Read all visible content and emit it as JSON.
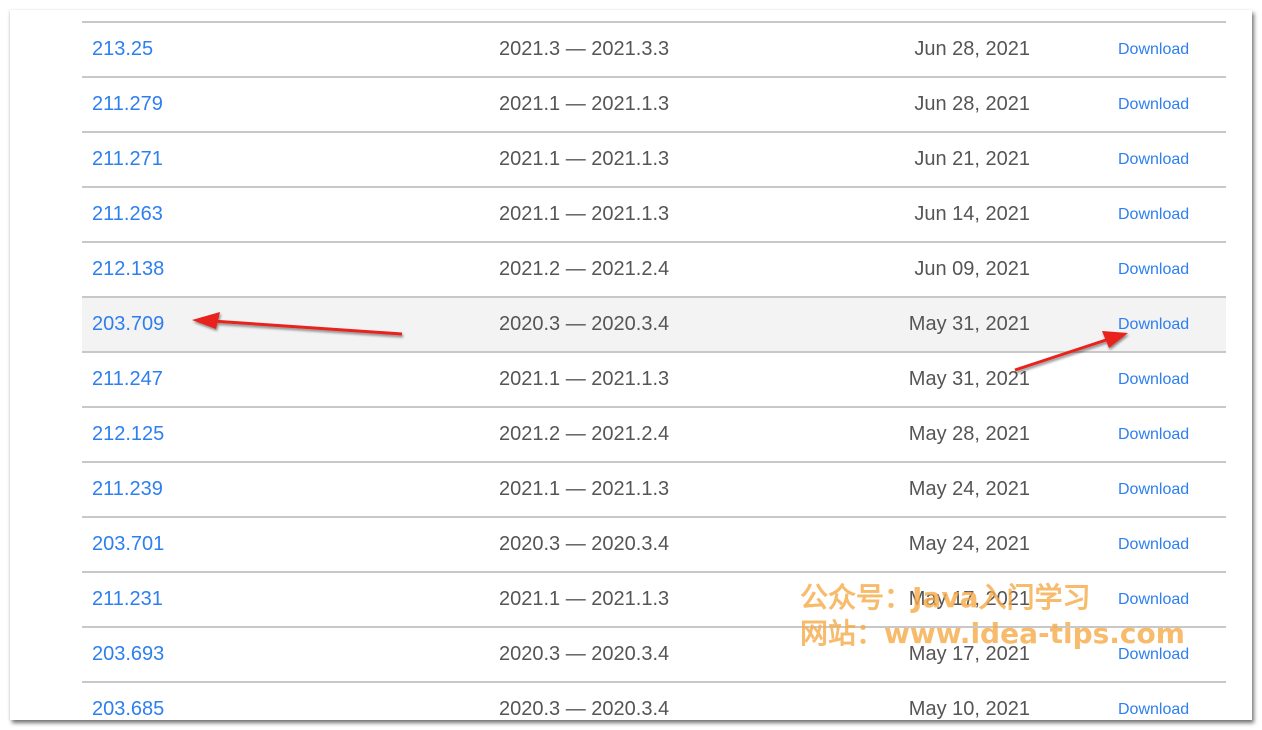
{
  "releases": {
    "download_label": "Download",
    "rows": [
      {
        "build": "213.25",
        "versions": "2021.3 — 2021.3.3",
        "date": "Jun 28, 2021",
        "highlighted": false
      },
      {
        "build": "211.279",
        "versions": "2021.1 — 2021.1.3",
        "date": "Jun 28, 2021",
        "highlighted": false
      },
      {
        "build": "211.271",
        "versions": "2021.1 — 2021.1.3",
        "date": "Jun 21, 2021",
        "highlighted": false
      },
      {
        "build": "211.263",
        "versions": "2021.1 — 2021.1.3",
        "date": "Jun 14, 2021",
        "highlighted": false
      },
      {
        "build": "212.138",
        "versions": "2021.2 — 2021.2.4",
        "date": "Jun 09, 2021",
        "highlighted": false
      },
      {
        "build": "203.709",
        "versions": "2020.3 — 2020.3.4",
        "date": "May 31, 2021",
        "highlighted": true
      },
      {
        "build": "211.247",
        "versions": "2021.1 — 2021.1.3",
        "date": "May 31, 2021",
        "highlighted": false
      },
      {
        "build": "212.125",
        "versions": "2021.2 — 2021.2.4",
        "date": "May 28, 2021",
        "highlighted": false
      },
      {
        "build": "211.239",
        "versions": "2021.1 — 2021.1.3",
        "date": "May 24, 2021",
        "highlighted": false
      },
      {
        "build": "203.701",
        "versions": "2020.3 — 2020.3.4",
        "date": "May 24, 2021",
        "highlighted": false
      },
      {
        "build": "211.231",
        "versions": "2021.1 — 2021.1.3",
        "date": "May 17, 2021",
        "highlighted": false
      },
      {
        "build": "203.693",
        "versions": "2020.3 — 2020.3.4",
        "date": "May 17, 2021",
        "highlighted": false
      },
      {
        "build": "203.685",
        "versions": "2020.3 — 2020.3.4",
        "date": "May 10, 2021",
        "highlighted": false
      }
    ]
  },
  "annotations": {
    "arrow_color": "#e8211a",
    "arrows": [
      "arrow-to-build-203.709",
      "arrow-to-download-203.709"
    ]
  },
  "watermark": {
    "line1": "公众号：Java入门学习",
    "line2": "网站：www.idea-tips.com",
    "color": "#f6aa46"
  }
}
